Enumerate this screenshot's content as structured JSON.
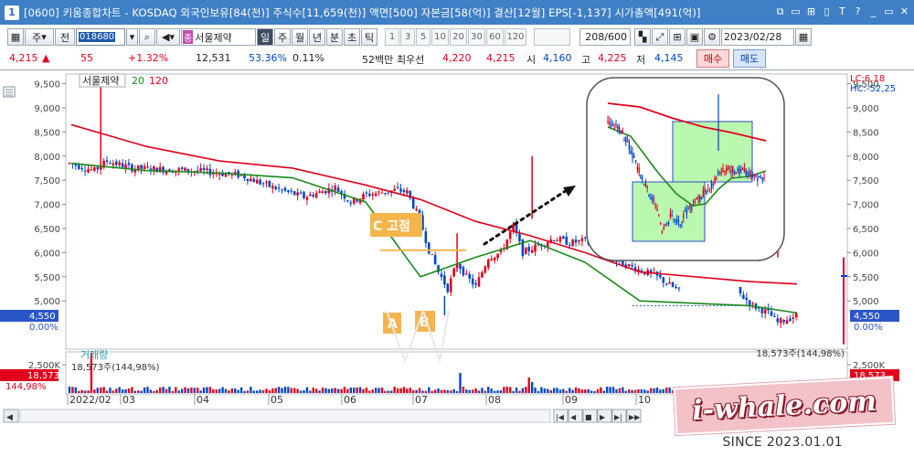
{
  "window": {
    "number": "1",
    "title": "[0600] 키움종합차트 - KOSDAQ 외국인보유[84(천)] 주식수[11,659(천)] 액면[500] 자본금[58(억)] 결산[12월] EPS[-1,137] 시가총액[491(억)]",
    "buttons": [
      "⧉",
      "▭",
      "⊞",
      "▯",
      "T",
      "?",
      "_",
      "▭",
      "✕"
    ]
  },
  "toolbar": {
    "dropdown1": "주",
    "dropdown2": "전",
    "code": "018680",
    "stock_name": "서울제약",
    "stock_badge": "종",
    "periods": [
      "일",
      "주",
      "월",
      "년",
      "분",
      "초",
      "틱"
    ],
    "active_period": "일",
    "numbers": [
      "1",
      "3",
      "5",
      "10",
      "20",
      "30",
      "60",
      "120"
    ],
    "count": "208/600",
    "date": "2023/02/28"
  },
  "quote": {
    "price": "4,215",
    "arrow": "▲",
    "change": "55",
    "change_pct": "+1.32%",
    "volume": "12,531",
    "ratio1": "53.36%",
    "ratio2": "0.11%",
    "low52_label": "52백만",
    "best_label": "최우선",
    "best_ask": "4,220",
    "best_bid": "4,215",
    "open_label": "시",
    "open": "4,160",
    "high_label": "고",
    "high": "4,225",
    "low_label": "저",
    "low": "4,145",
    "buy_label": "매수",
    "sell_label": "매도"
  },
  "chart": {
    "legend_name": "서울제약",
    "ma_short_label": "20",
    "ma_long_label": "120",
    "lc_label": "LC:6,18",
    "hc_label": "HC:-52,25",
    "y_ticks": [
      "9,500",
      "9,000",
      "8,500",
      "8,000",
      "7,500",
      "7,000",
      "6,500",
      "6,000",
      "5,500",
      "5,000"
    ],
    "current_price_tag": "4,550",
    "current_pct_tag": "0.00%",
    "annotation_c": "C 고점",
    "annotation_a": "A",
    "annotation_b": "B",
    "volume_label": "거래량",
    "volume_value": "18,573주(144,98%)",
    "volume_value_right": "18,573주(144,98%)",
    "volume_tick": "2,500K",
    "volume_tag": "18,573",
    "volume_pct_tag": "144,98%",
    "x_labels": [
      "2022/02",
      "03",
      "04",
      "05",
      "06",
      "07",
      "08",
      "09",
      "10"
    ],
    "colors": {
      "up": "#e1001b",
      "down": "#0046c8",
      "ma20": "#1a8a1a",
      "ma120": "#e1001b",
      "annotation": "#f5b54d",
      "inset_box": "#a9f59b"
    }
  },
  "chart_data": {
    "type": "candlestick",
    "title": "서울제약",
    "ylim": [
      4000,
      9700
    ],
    "categories": [
      "2022/02",
      "03",
      "04",
      "05",
      "06",
      "07",
      "08",
      "09",
      "10"
    ],
    "series": [
      {
        "name": "20",
        "values": [
          7850,
          7700,
          7650,
          7550,
          7050,
          5500,
          5900,
          6250,
          5800,
          5000,
          4900,
          4750
        ]
      },
      {
        "name": "120",
        "values": [
          8650,
          8200,
          7900,
          7750,
          7400,
          7100,
          6650,
          6350,
          6000,
          5600,
          5400,
          5350
        ]
      }
    ]
  },
  "footer": {
    "watermark": "i-whale.com",
    "since": "SINCE 2023.01.01"
  }
}
